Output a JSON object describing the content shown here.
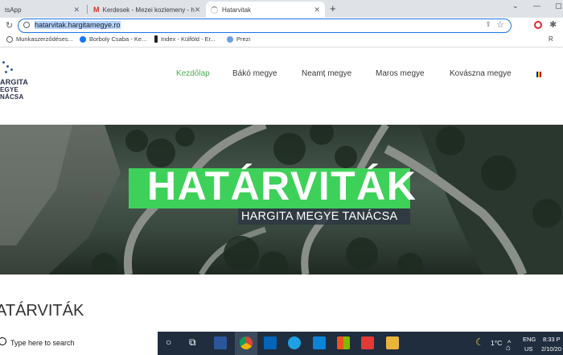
{
  "browser": {
    "tabs": [
      {
        "label": "tsApp",
        "active": false
      },
      {
        "label": "Kerdesek - Mezei kozlemeny - h",
        "active": false
      },
      {
        "label": "Hatarvitak",
        "active": true
      }
    ],
    "new_tab_glyph": "+",
    "url_selected": "hatarvitak.hargitamegye.ro",
    "bookmarks": [
      {
        "label": "Munkaszerződéses...",
        "icon": "globe-icon"
      },
      {
        "label": "Borboly Csaba - Ke...",
        "icon": "facebook-icon"
      },
      {
        "label": "Index - Külföld - Er...",
        "icon": "index-icon"
      },
      {
        "label": "Prezi",
        "icon": "prezi-icon"
      }
    ],
    "bookmark_more": "R"
  },
  "site": {
    "logo_lines": [
      "ARGITA",
      "EGYE",
      "NÁCSA"
    ],
    "nav": [
      {
        "label": "Kezdőlap",
        "active": true
      },
      {
        "label": "Bákó megye",
        "active": false
      },
      {
        "label": "Neamț megye",
        "active": false
      },
      {
        "label": "Maros megye",
        "active": false
      },
      {
        "label": "Kovászna megye",
        "active": false
      }
    ],
    "hero_title": "HATÁRVITÁK",
    "hero_subtitle": "HARGITA MEGYE TANÁCSA",
    "content_title": "ATÁRVITÁK",
    "accent_color": "#3ed15a"
  },
  "taskbar": {
    "search_placeholder": "Type here to search",
    "weather": "1°C",
    "lang_top": "ENG",
    "lang_bottom": "US",
    "time": "8:33 P",
    "date": "2/10/20"
  }
}
